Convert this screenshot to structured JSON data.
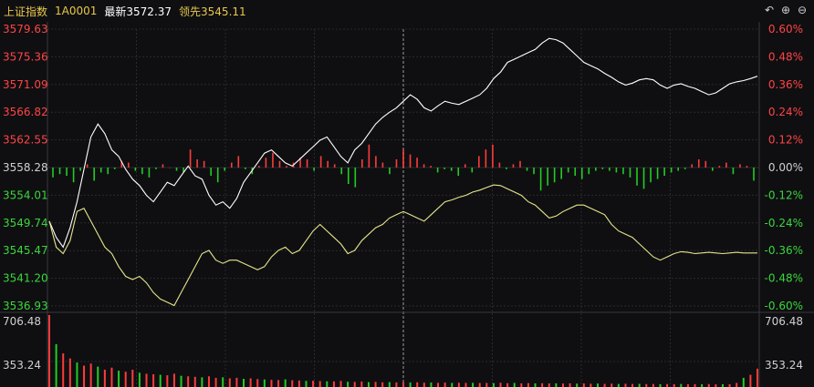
{
  "header": {
    "name": "上证指数",
    "code": "1A0001",
    "latest": "最新3572.37",
    "leader": "领先3545.11"
  },
  "toolbar": {
    "buttons": [
      {
        "name": "undo-icon",
        "glyph": "↶"
      },
      {
        "name": "zoom-in-icon",
        "glyph": "⊕"
      },
      {
        "name": "zoom-out-icon",
        "glyph": "⊖"
      }
    ]
  },
  "colors": {
    "up": "#ff3b3b",
    "down": "#22cc22",
    "price_line": "#ffffff",
    "leader_line": "#e6e68a",
    "axis_left_up": "#ff4444",
    "axis_neutral": "#d0d0d0",
    "axis_left_down": "#3bd63b",
    "grid": "#2a2a2e"
  },
  "chart_data": {
    "type": "line",
    "price_axis": {
      "ylim": [
        3536.93,
        3579.63
      ],
      "tick_labels": [
        "3579.63",
        "3575.36",
        "3571.09",
        "3566.82",
        "3562.55",
        "3558.28",
        "3554.01",
        "3549.74",
        "3545.47",
        "3541.20",
        "3536.93"
      ],
      "pct_labels": [
        "0.60%",
        "0.48%",
        "0.36%",
        "0.24%",
        "0.12%",
        "0.00%",
        "-0.12%",
        "-0.24%",
        "-0.36%",
        "-0.48%",
        "-0.60%"
      ],
      "reference": 3558.28
    },
    "volume_axis": {
      "ylim": [
        0,
        706.48
      ],
      "tick_labels_left": [
        "706.48",
        "353.24"
      ],
      "tick_labels_right": [
        "706.48",
        "353.24"
      ]
    },
    "series": [
      {
        "key": "price",
        "values": [
          3550.0,
          3547.5,
          3546.0,
          3549.0,
          3553.0,
          3558.0,
          3563.0,
          3565.0,
          3563.5,
          3561.0,
          3560.0,
          3558.0,
          3556.5,
          3555.5,
          3554.0,
          3553.0,
          3554.5,
          3556.0,
          3555.5,
          3557.0,
          3558.5,
          3557.0,
          3556.5,
          3554.0,
          3552.5,
          3553.0,
          3552.0,
          3553.5,
          3556.0,
          3557.5,
          3559.0,
          3560.5,
          3561.0,
          3560.0,
          3559.0,
          3558.5,
          3559.5,
          3560.5,
          3561.5,
          3562.5,
          3563.0,
          3561.5,
          3560.0,
          3559.0,
          3561.0,
          3562.0,
          3563.5,
          3565.0,
          3566.0,
          3566.8,
          3567.5,
          3568.5,
          3569.5,
          3568.8,
          3567.5,
          3567.0,
          3567.8,
          3568.5,
          3568.2,
          3568.0,
          3568.5,
          3569.0,
          3569.5,
          3570.5,
          3572.0,
          3573.0,
          3574.5,
          3575.0,
          3575.5,
          3576.0,
          3576.5,
          3577.5,
          3578.2,
          3578.0,
          3577.5,
          3576.5,
          3575.5,
          3574.5,
          3574.0,
          3573.5,
          3572.8,
          3572.2,
          3571.5,
          3571.0,
          3571.3,
          3571.8,
          3572.0,
          3571.8,
          3571.0,
          3570.5,
          3571.0,
          3571.2,
          3570.8,
          3570.5,
          3570.0,
          3569.5,
          3569.8,
          3570.5,
          3571.2,
          3571.5,
          3571.7,
          3572.0,
          3572.37
        ],
        "color_key": "price_line"
      },
      {
        "key": "leader",
        "values": [
          3550.0,
          3546.0,
          3545.0,
          3547.0,
          3551.5,
          3552.0,
          3550.0,
          3548.0,
          3546.0,
          3545.0,
          3543.0,
          3541.5,
          3541.0,
          3541.5,
          3540.5,
          3539.0,
          3538.0,
          3537.5,
          3537.0,
          3539.0,
          3541.0,
          3543.0,
          3545.0,
          3545.5,
          3544.0,
          3543.5,
          3544.0,
          3544.0,
          3543.5,
          3543.0,
          3542.5,
          3543.0,
          3544.5,
          3545.5,
          3546.0,
          3545.0,
          3545.5,
          3547.0,
          3548.5,
          3549.5,
          3548.5,
          3547.5,
          3546.5,
          3545.0,
          3545.5,
          3547.0,
          3548.0,
          3549.0,
          3549.5,
          3550.5,
          3551.0,
          3551.5,
          3551.0,
          3550.5,
          3550.0,
          3551.0,
          3552.0,
          3553.0,
          3553.3,
          3553.7,
          3554.0,
          3554.5,
          3554.8,
          3555.2,
          3555.6,
          3555.5,
          3555.0,
          3554.5,
          3554.0,
          3553.0,
          3552.5,
          3551.5,
          3550.5,
          3550.8,
          3551.5,
          3552.0,
          3552.5,
          3552.5,
          3552.0,
          3551.5,
          3551.0,
          3549.5,
          3548.5,
          3548.0,
          3547.5,
          3546.5,
          3545.5,
          3544.5,
          3544.0,
          3544.5,
          3545.0,
          3545.3,
          3545.2,
          3545.0,
          3545.1,
          3545.2,
          3545.1,
          3545.0,
          3545.1,
          3545.2,
          3545.1,
          3545.11,
          3545.11
        ],
        "color_key": "leader_line"
      }
    ],
    "breadth_bars": [
      -0.3,
      -0.2,
      -0.25,
      -0.45,
      -0.1,
      0.1,
      -0.4,
      -0.15,
      -0.2,
      -0.05,
      0.2,
      0.15,
      -0.1,
      -0.2,
      -0.3,
      -0.05,
      0.1,
      0.0,
      -0.1,
      -0.15,
      0.55,
      0.25,
      0.2,
      -0.25,
      -0.45,
      -0.1,
      0.15,
      0.35,
      -0.05,
      -0.2,
      0.05,
      0.3,
      0.45,
      0.2,
      0.05,
      0.15,
      0.3,
      0.25,
      -0.1,
      0.35,
      0.2,
      0.1,
      -0.2,
      -0.5,
      -0.6,
      0.25,
      0.7,
      0.35,
      0.15,
      -0.2,
      0.25,
      0.55,
      0.4,
      0.3,
      0.1,
      0.05,
      -0.15,
      -0.05,
      -0.1,
      -0.25,
      0.1,
      -0.15,
      0.35,
      0.55,
      0.7,
      0.15,
      -0.05,
      0.1,
      0.2,
      -0.1,
      -0.2,
      -0.7,
      -0.55,
      -0.45,
      -0.35,
      -0.15,
      -0.25,
      -0.35,
      -0.2,
      -0.1,
      -0.05,
      -0.1,
      -0.15,
      -0.2,
      -0.3,
      -0.55,
      -0.65,
      -0.45,
      -0.35,
      -0.25,
      -0.15,
      -0.1,
      -0.05,
      0.1,
      0.25,
      0.2,
      -0.1,
      0.05,
      0.15,
      -0.2,
      0.1,
      0.05,
      -0.4
    ],
    "volume": [
      706.48,
      420,
      330,
      280,
      240,
      210,
      230,
      200,
      170,
      190,
      160,
      150,
      170,
      140,
      130,
      125,
      120,
      115,
      130,
      110,
      105,
      100,
      95,
      105,
      90,
      95,
      85,
      90,
      80,
      85,
      78,
      74,
      70,
      68,
      75,
      66,
      64,
      60,
      62,
      58,
      56,
      55,
      60,
      52,
      50,
      54,
      48,
      50,
      46,
      48,
      45,
      47,
      44,
      46,
      42,
      44,
      41,
      43,
      40,
      42,
      40,
      41,
      39,
      40,
      38,
      42,
      37,
      40,
      36,
      38,
      36,
      37,
      35,
      36,
      34,
      36,
      33,
      35,
      32,
      34,
      31,
      33,
      30,
      32,
      30,
      31,
      29,
      30,
      28,
      29,
      28,
      30,
      27,
      28,
      27,
      29,
      26,
      28,
      27,
      40,
      90,
      120,
      180
    ]
  }
}
